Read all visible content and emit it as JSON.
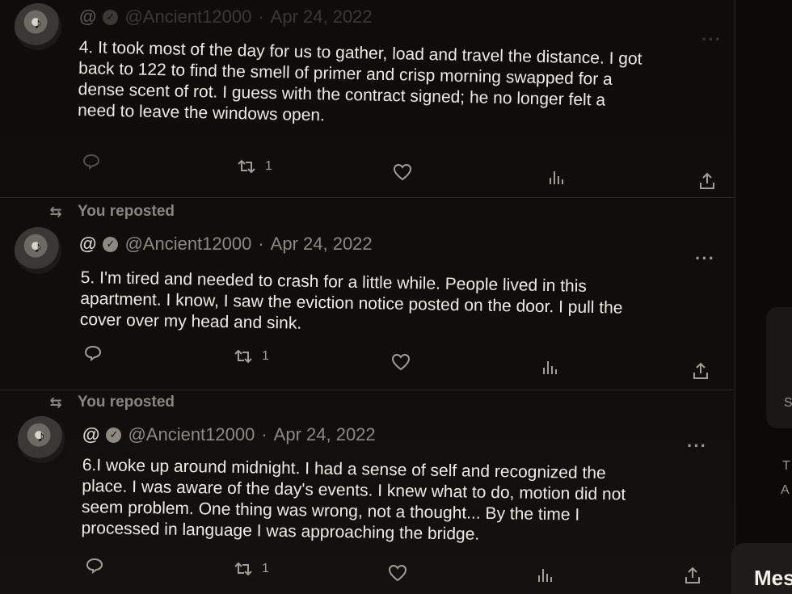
{
  "posts": [
    {
      "repost_label": "",
      "handle_at": "@",
      "username": "@Ancient12000",
      "date": "Apr 24, 2022",
      "lines": [
        "4. It took most of the day for us to gather, load and travel the distance. I got",
        "back to 122 to find the smell of primer and crisp morning swapped for a",
        "dense scent of rot. I guess with the contract signed; he no longer felt a",
        "need to leave the windows open."
      ],
      "repost_count": "1"
    },
    {
      "repost_label": "You reposted",
      "handle_at": "@",
      "username": "@Ancient12000",
      "date": "Apr 24, 2022",
      "lines": [
        "5. I'm tired and needed to crash for a little while. People lived in this",
        "apartment. I know, I saw the eviction notice posted on the door. I pull the",
        "cover over my head and sink."
      ],
      "repost_count": "1"
    },
    {
      "repost_label": "You reposted",
      "handle_at": "@",
      "username": "@Ancient12000",
      "date": "Apr 24, 2022",
      "lines": [
        "6.I woke up around midnight. I had a sense of self and recognized the",
        "place. I was aware of the day's events. I knew what to do, motion did not",
        "seem problem. One thing was wrong, not a thought... By the time I",
        "processed in language I was approaching the bridge."
      ],
      "repost_count": "1"
    }
  ],
  "date_separator": "·",
  "more_label": "···",
  "messages_label": "Messages",
  "right_fragments": [
    "S",
    "T",
    "A"
  ],
  "icons": {
    "reply": "speech-bubble-icon",
    "repost": "repost-arrows-icon",
    "like": "heart-icon",
    "views": "bar-chart-icon",
    "share": "share-upload-icon",
    "verified": "verified-badge-icon"
  },
  "colors": {
    "background": "#0b0a09",
    "text": "#eeeae3",
    "muted": "#8d8880"
  }
}
